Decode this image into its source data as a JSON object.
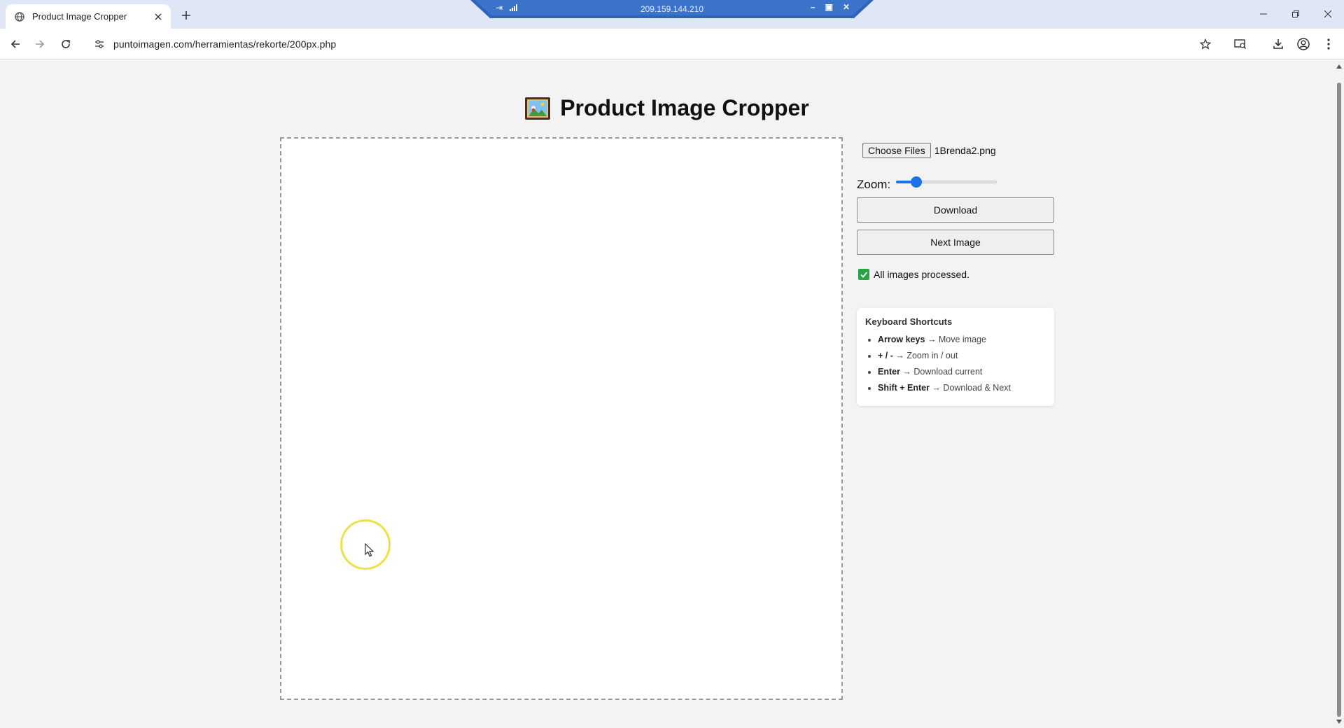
{
  "browser": {
    "tab_title": "Product Image Cropper",
    "url": "puntoimagen.com/herramientas/rekorte/200px.php",
    "remote_session_ip": "209.159.144.210"
  },
  "page": {
    "title": "Product Image Cropper",
    "file_button_label": "Choose Files",
    "file_name": "1Brenda2.png",
    "zoom_label": "Zoom:",
    "zoom_level_fraction": 0.2,
    "download_label": "Download",
    "next_label": "Next Image",
    "status_text": "All images processed.",
    "status_color": "#2aa342",
    "shortcuts": {
      "title": "Keyboard Shortcuts",
      "items": [
        {
          "key": "Arrow keys",
          "action": "Move image"
        },
        {
          "key": "+ / -",
          "action": "Zoom in / out"
        },
        {
          "key": "Enter",
          "action": "Download current"
        },
        {
          "key": "Shift + Enter",
          "action": "Download & Next"
        }
      ]
    }
  },
  "icons": {
    "favicon": "globe-icon",
    "back": "back-arrow-icon",
    "forward": "forward-arrow-icon",
    "reload": "reload-icon",
    "site_info": "tune-icon",
    "bookmark": "star-icon",
    "cast": "cast-search-icon",
    "downloads": "download-icon",
    "profile": "profile-icon",
    "menu": "kebab-menu-icon",
    "heading": "framed-picture-icon"
  },
  "colors": {
    "accent": "#1a73e8",
    "chrome_tabbar": "#dfe7f6"
  }
}
